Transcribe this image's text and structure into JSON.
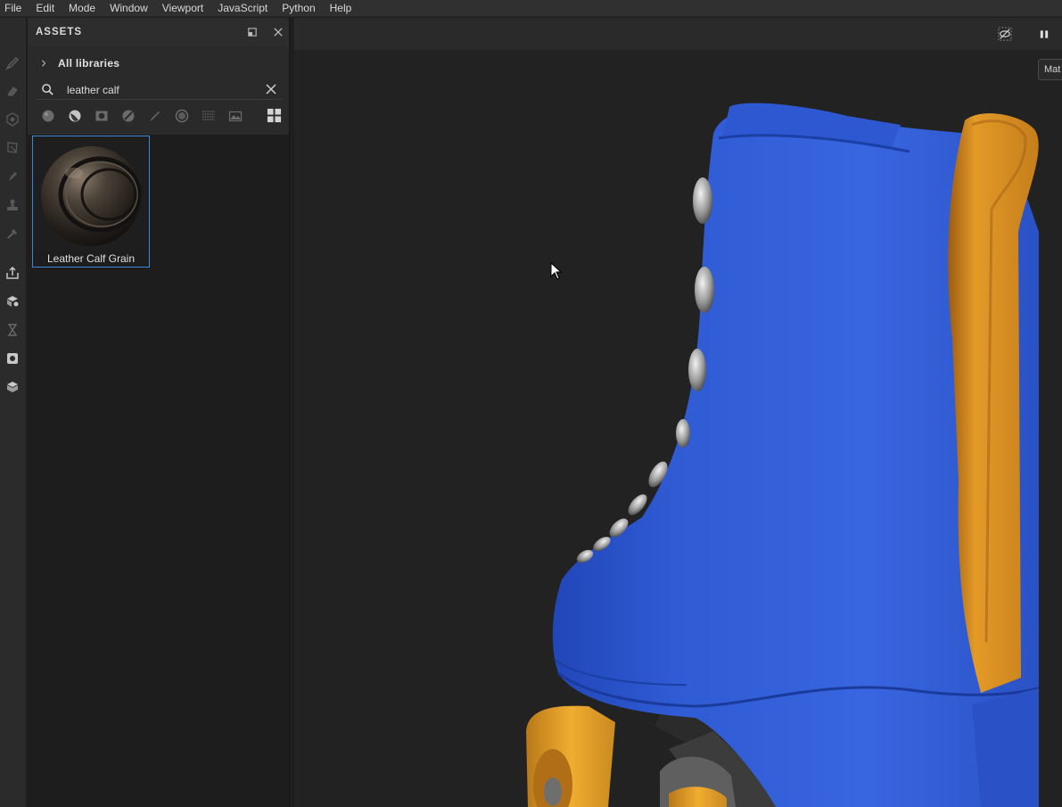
{
  "menu": [
    "File",
    "Edit",
    "Mode",
    "Window",
    "Viewport",
    "JavaScript",
    "Python",
    "Help"
  ],
  "toolbar": {
    "tools": [
      "paint-brush",
      "eraser",
      "projection",
      "polygon-fill",
      "smudge",
      "clone-stamp",
      "color-picker",
      "export",
      "bake-mesh-maps",
      "timeline",
      "iray-render",
      "display-settings"
    ]
  },
  "assets_panel": {
    "title": "ASSETS",
    "library_label": "All libraries",
    "search": {
      "value": "leather calf"
    },
    "filters": [
      "material-filter",
      "smart-material-filter",
      "mask-filter",
      "smart-mask-filter",
      "brush-filter",
      "alpha-filter",
      "procedural-filter",
      "environment-filter"
    ],
    "results": [
      {
        "name": "Leather Calf Grain"
      }
    ]
  },
  "viewport": {
    "side_tab": "Mat",
    "colors": {
      "boot": "#2f5bd4",
      "strap": "#e49a26",
      "wheel": "#e9a526",
      "background": "#222222"
    }
  }
}
